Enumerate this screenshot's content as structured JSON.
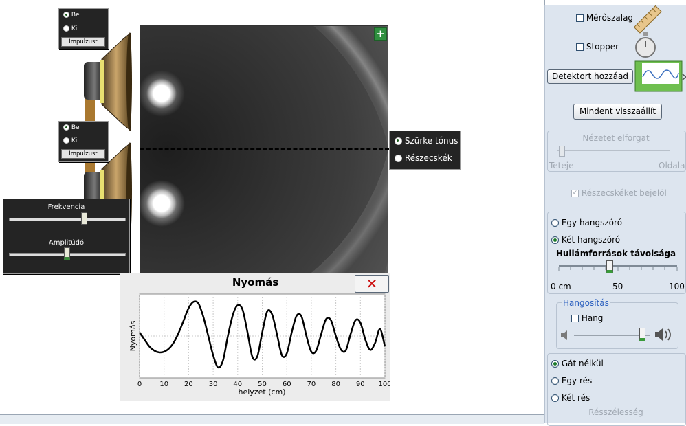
{
  "speaker1": {
    "on_label": "Be",
    "off_label": "Ki",
    "pulse_label": "Impulzust"
  },
  "speaker2": {
    "on_label": "Be",
    "off_label": "Ki",
    "pulse_label": "Impulzust"
  },
  "sliders": {
    "frequency_label": "Frekvencia",
    "frequency_value": 0.65,
    "amplitude_label": "Amplitúdó",
    "amplitude_value": 0.5
  },
  "view_mode": {
    "options": [
      "Szürke tónus",
      "Részecskék"
    ],
    "selected": "Szürke tónus"
  },
  "wave_view": {
    "zoom_icon": "plus-icon"
  },
  "tools": {
    "tape_label": "Mérőszalag",
    "stopwatch_label": "Stopper",
    "detector_button": "Detektort hozzáad",
    "reset_button": "Mindent visszaállít"
  },
  "rotate": {
    "title": "Nézetet elforgat",
    "left_label": "Teteje",
    "right_label": "Oldala"
  },
  "mark_particles_label": "Részecskéket bejelöl",
  "sources": {
    "one_label": "Egy hangszóró",
    "two_label": "Két hangszóró",
    "selected": "Két hangszóró",
    "distance_title": "Hullámforrások távolsága",
    "distance_min": "0 cm",
    "distance_mid": "50",
    "distance_max": "100",
    "distance_value": 0.43
  },
  "audio": {
    "title": "Hangosítás",
    "sound_label": "Hang",
    "volume_value": 0.9
  },
  "barrier": {
    "none_label": "Gát nélkül",
    "one_slit_label": "Egy rés",
    "two_slit_label": "Két rés",
    "selected": "Gát nélkül",
    "slit_width_label": "Résszélesség"
  },
  "chart_data": {
    "type": "line",
    "title": "Nyomás",
    "xlabel": "helyzet (cm)",
    "ylabel": "Nyomás",
    "xlim": [
      0,
      100
    ],
    "xticks": [
      "0",
      "10",
      "20",
      "30",
      "40",
      "50",
      "60",
      "70",
      "80",
      "90",
      "100"
    ],
    "x": [
      0,
      2,
      4,
      6,
      8,
      10,
      12,
      14,
      16,
      18,
      20,
      22,
      24,
      26,
      28,
      30,
      32,
      34,
      36,
      38,
      40,
      42,
      44,
      46,
      48,
      50,
      52,
      54,
      56,
      58,
      60,
      62,
      64,
      66,
      68,
      70,
      72,
      74,
      76,
      78,
      80,
      82,
      84,
      86,
      88,
      90,
      92,
      94,
      96,
      98,
      100
    ],
    "y": [
      0.1,
      -0.1,
      -0.3,
      -0.42,
      -0.47,
      -0.45,
      -0.36,
      -0.18,
      0.1,
      0.45,
      0.8,
      0.98,
      0.93,
      0.55,
      0.0,
      -0.55,
      -0.9,
      -0.7,
      0.0,
      0.6,
      0.88,
      0.75,
      0.1,
      -0.6,
      -0.58,
      0.1,
      0.7,
      0.62,
      0.05,
      -0.55,
      -0.5,
      0.1,
      0.58,
      0.56,
      0.0,
      -0.45,
      -0.42,
      0.05,
      0.48,
      0.45,
      0.0,
      -0.38,
      -0.42,
      0.05,
      0.45,
      0.38,
      -0.1,
      -0.4,
      -0.2,
      0.2,
      -0.3
    ],
    "ylim": [
      -1.2,
      1.2
    ],
    "grid": true
  }
}
